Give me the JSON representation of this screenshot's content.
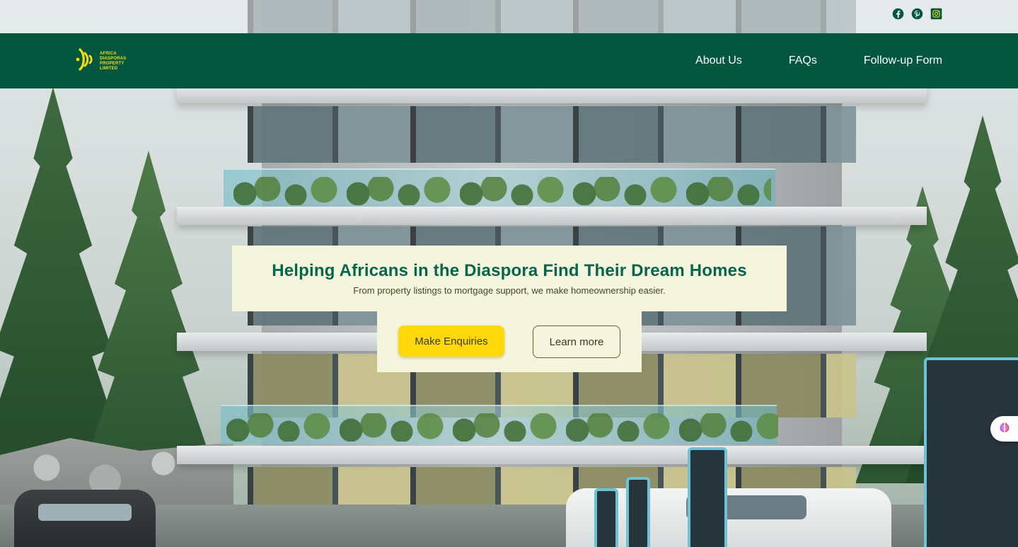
{
  "brand": {
    "logo_lines": [
      "AFRICA",
      "DIASPORAS",
      "PROPERTY",
      "LIMITED"
    ],
    "logo_color": "#f5dd10"
  },
  "topbar": {
    "social_icons": [
      "facebook-icon",
      "pinterest-icon",
      "instagram-icon"
    ]
  },
  "nav": {
    "items": [
      {
        "label": "About Us"
      },
      {
        "label": "FAQs"
      },
      {
        "label": "Follow-up Form"
      }
    ],
    "background": "#02573e"
  },
  "hero": {
    "title": "Helping Africans in the Diaspora Find Their Dream Homes",
    "subtitle": "From property listings to mortgage support, we make homeownership easier.",
    "primary_cta": "Make Enquiries",
    "secondary_cta": "Learn more",
    "card_color": "#f4f5dc",
    "title_color": "#04674a",
    "primary_color": "#ffd80a"
  },
  "widget": {
    "icon": "brain-icon"
  }
}
